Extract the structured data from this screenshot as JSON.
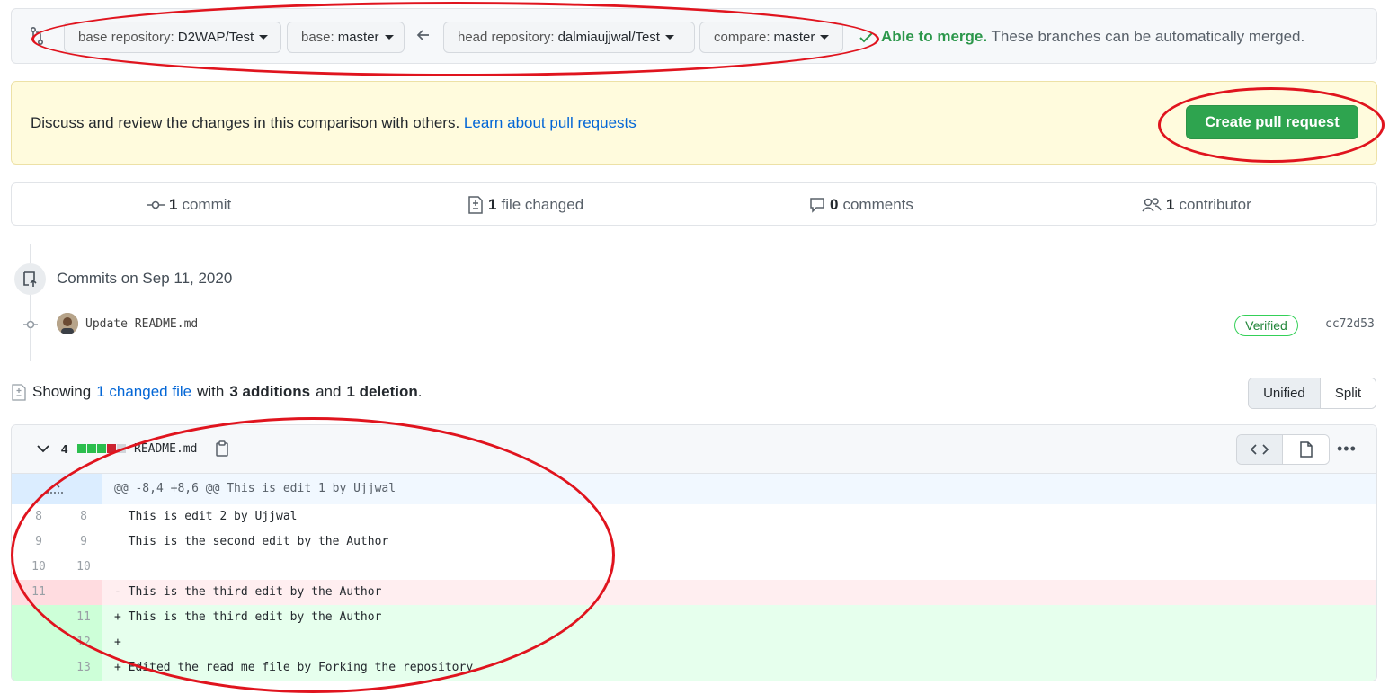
{
  "compare": {
    "base_repo_label": "base repository:",
    "base_repo_value": "D2WAP/Test",
    "base_branch_label": "base:",
    "base_branch_value": "master",
    "head_repo_label": "head repository:",
    "head_repo_value": "dalmiaujjwal/Test",
    "compare_label": "compare:",
    "compare_value": "master",
    "merge_status": "Able to merge.",
    "merge_detail": " These branches can be automatically merged."
  },
  "flash": {
    "text": "Discuss and review the changes in this comparison with others. ",
    "link": "Learn about pull requests",
    "button": "Create pull request"
  },
  "summary": {
    "commits_count": "1",
    "commits_label": "commit",
    "files_count": "1",
    "files_label": "file changed",
    "comments_count": "0",
    "comments_label": "comments",
    "contributors_count": "1",
    "contributors_label": "contributor"
  },
  "commits": {
    "date_heading": "Commits on Sep 11, 2020",
    "message": "Update README.md",
    "badge": "Verified",
    "sha": "cc72d53"
  },
  "toc": {
    "showing": "Showing",
    "changed_files": "1 changed file",
    "with": "with",
    "additions": "3 additions",
    "and": "and",
    "deletions": "1 deletion",
    "period": "."
  },
  "view_toggle": {
    "unified": "Unified",
    "split": "Split"
  },
  "file": {
    "change_count": "4",
    "name": "README.md",
    "hunk_header": "@@ -8,4 +8,6 @@ This is edit 1 by Ujjwal",
    "lines": [
      {
        "old": "8",
        "new": "8",
        "type": "context",
        "text": "  This is edit 2 by Ujjwal"
      },
      {
        "old": "9",
        "new": "9",
        "type": "context",
        "text": "  This is the second edit by the Author"
      },
      {
        "old": "10",
        "new": "10",
        "type": "context",
        "text": ""
      },
      {
        "old": "11",
        "new": "",
        "type": "del",
        "text": "- This is the third edit by the Author"
      },
      {
        "old": "",
        "new": "11",
        "type": "add",
        "text": "+ This is the third edit by the Author"
      },
      {
        "old": "",
        "new": "12",
        "type": "add",
        "text": "+"
      },
      {
        "old": "",
        "new": "13",
        "type": "add",
        "text": "+ Edited the read me file by Forking the repository"
      }
    ]
  },
  "colors": {
    "accent": "#2ea44f",
    "link": "#0366d6",
    "del_bg": "#ffeef0",
    "add_bg": "#e6ffed",
    "annotation": "#e0141e"
  }
}
